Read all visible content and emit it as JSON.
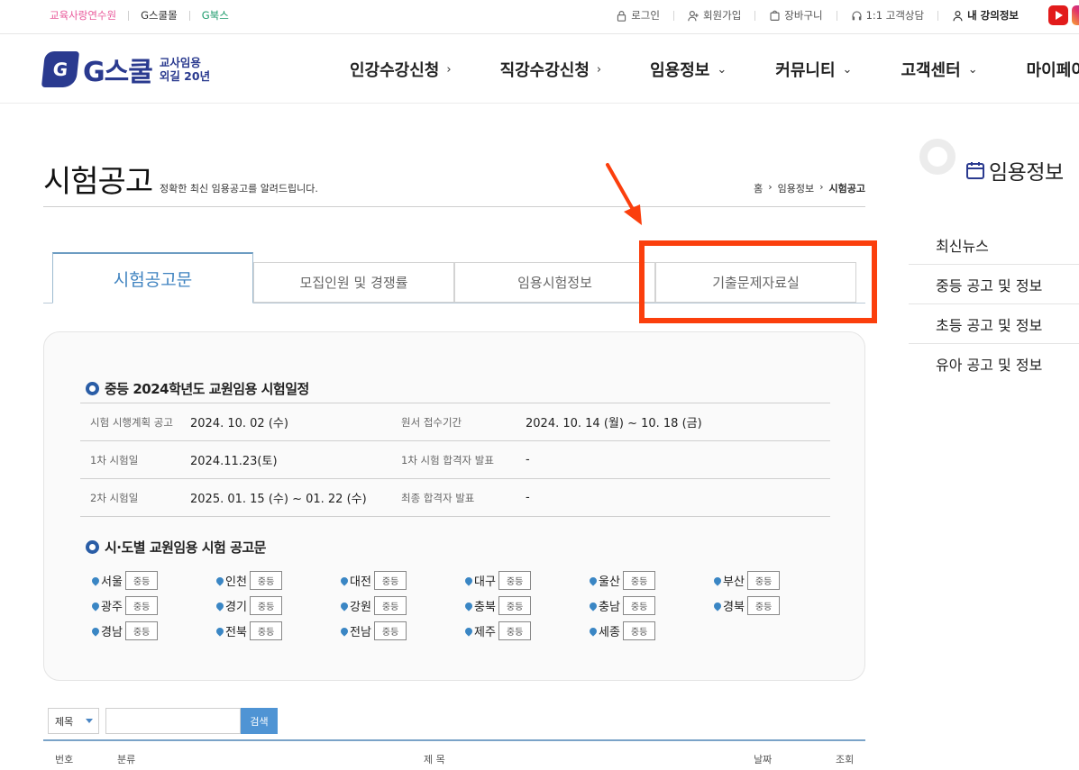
{
  "util": {
    "left_links": [
      "교육사랑연수원",
      "G스쿨몰",
      "G북스"
    ],
    "right_links": [
      "로그인",
      "회원가입",
      "장바구니",
      "1:1 고객상담",
      "내 강의정보"
    ]
  },
  "header": {
    "logo_badge": "G",
    "logo_text": "G스쿨",
    "logo_sub1": "교사임용",
    "logo_sub2": "외길 20년",
    "nav": [
      "인강수강신청",
      "직강수강신청",
      "임용정보",
      "커뮤니티",
      "고객센터",
      "마이페이"
    ],
    "nav_chev": [
      "›",
      "›",
      "⌄",
      "⌄",
      "⌄",
      ""
    ]
  },
  "page": {
    "title": "시험공고",
    "desc": "정확한 최신 임용공고를 알려드립니다.",
    "breadcrumb": [
      "홈",
      "›",
      "임용정보",
      "›",
      "시험공고"
    ]
  },
  "tabs": [
    "시험공고문",
    "모집인원 및 경쟁률",
    "임용시험정보",
    "기출문제자료실"
  ],
  "schedule": {
    "title": "중등 2024학년도 교원임용 시험일정",
    "rows": [
      {
        "k1": "시험 시행계획 공고",
        "v1": "2024. 10. 02 (수)",
        "k2": "원서 접수기간",
        "v2": "2024. 10. 14 (월) ~ 10. 18 (금)"
      },
      {
        "k1": "1차 시험일",
        "v1": "2024.11.23(토)",
        "k2": "1차 시험 합격자 발표",
        "v2": "-"
      },
      {
        "k1": "2차 시험일",
        "v1": "2025. 01. 15 (수) ~ 01. 22 (수)",
        "k2": "최종 합격자 발표",
        "v2": "-"
      }
    ]
  },
  "regions": {
    "title": "시·도별 교원임용 시험 공고문",
    "badge": "중등",
    "items": [
      "서울",
      "인천",
      "대전",
      "대구",
      "울산",
      "부산",
      "광주",
      "경기",
      "강원",
      "충북",
      "충남",
      "경북",
      "경남",
      "전북",
      "전남",
      "제주",
      "세종"
    ]
  },
  "search": {
    "select_value": "제목",
    "button": "검색"
  },
  "list_header": [
    "번호",
    "분류",
    "제 목",
    "날짜",
    "조회"
  ],
  "sidebar": {
    "title": "임용정보",
    "items": [
      "최신뉴스",
      "중등 공고 및 정보",
      "초등 공고 및 정보",
      "유아 공고 및 정보"
    ]
  },
  "colors": {
    "accent": "#3f83c0",
    "highlight": "#fb3f0d",
    "brand": "#2a3a8f"
  }
}
